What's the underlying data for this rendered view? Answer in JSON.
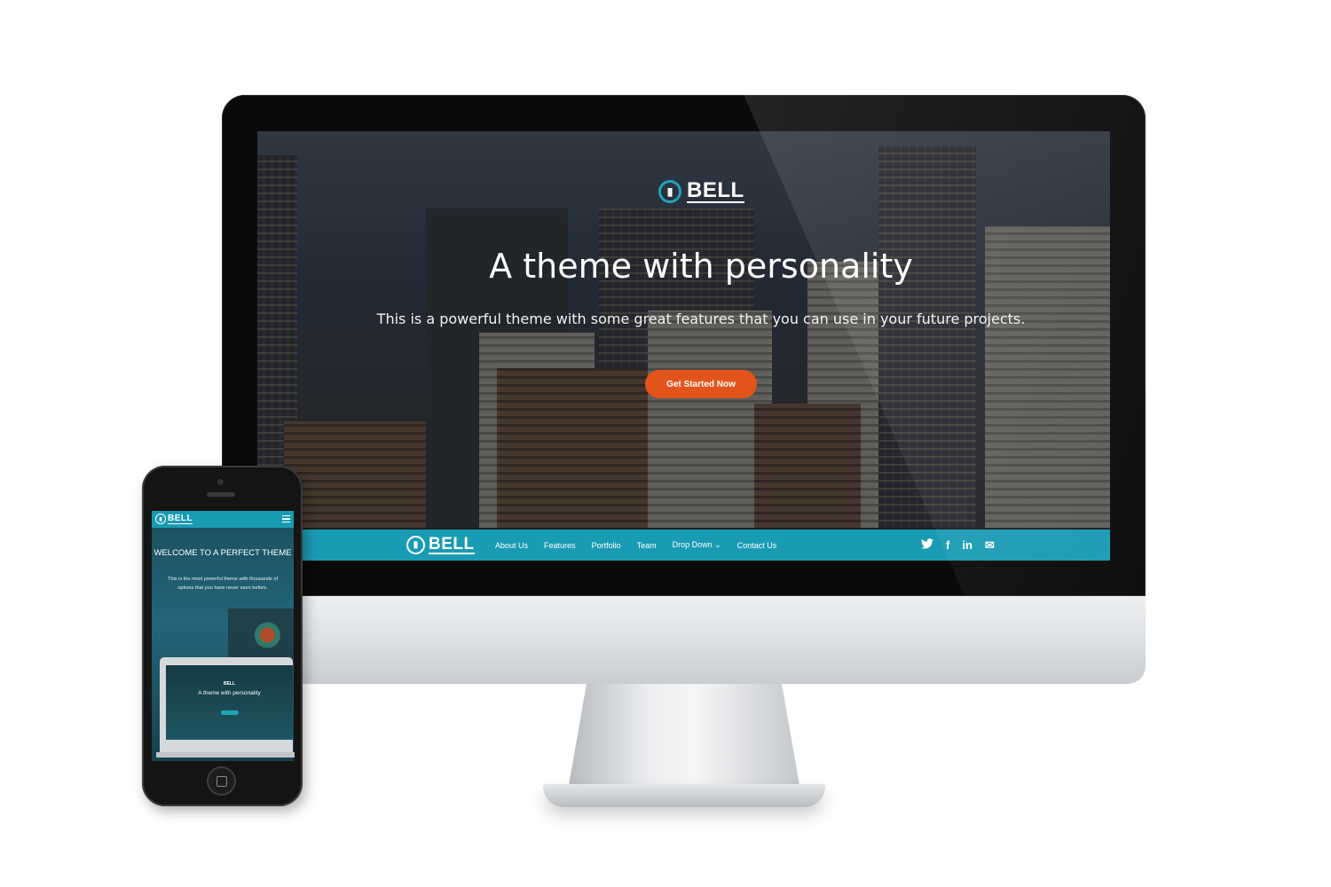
{
  "desktop": {
    "brand": "BELL",
    "hero_title": "A theme with personality",
    "hero_subtitle": "This is a powerful theme with some great features that you can use in your future projects.",
    "cta_label": "Get Started Now",
    "nav": {
      "brand": "BELL",
      "links": [
        "About Us",
        "Features",
        "Portfolio",
        "Team",
        "Drop Down",
        "Contact Us"
      ],
      "dropdown_caret": "⌄",
      "social": [
        "twitter-icon",
        "facebook-icon",
        "linkedin-icon",
        "email-icon"
      ]
    },
    "colors": {
      "accent": "#1a9bb4",
      "cta": "#e3541b"
    }
  },
  "mobile": {
    "brand": "BELL",
    "hero_title": "WELCOME TO A PERFECT THEME",
    "hero_subtitle": "This is the most powerful theme with thousands of options that you have never seen before.",
    "laptop": {
      "brand": "BELL",
      "title": "A theme with personality"
    }
  }
}
